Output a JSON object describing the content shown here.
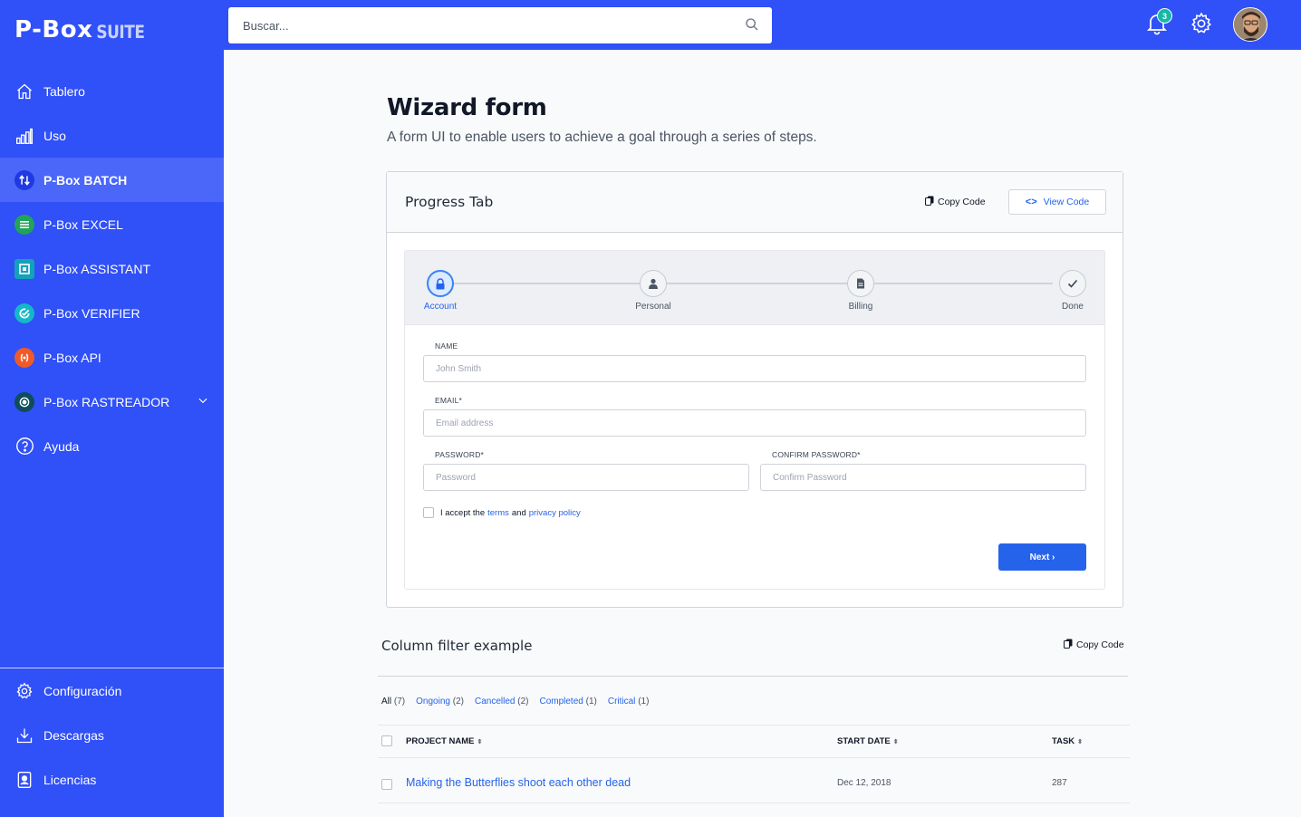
{
  "logo": {
    "main": "P-Box",
    "suffix": "SUITE"
  },
  "sidebar": {
    "items": [
      {
        "label": "Tablero",
        "icon": "home-icon"
      },
      {
        "label": "Uso",
        "icon": "bar-chart-icon"
      },
      {
        "label": "P-Box BATCH",
        "icon": "transfer-icon",
        "active": true
      },
      {
        "label": "P-Box EXCEL",
        "icon": "excel-icon"
      },
      {
        "label": "P-Box ASSISTANT",
        "icon": "assistant-icon"
      },
      {
        "label": "P-Box VERIFIER",
        "icon": "verifier-icon"
      },
      {
        "label": "P-Box API",
        "icon": "api-icon"
      },
      {
        "label": "P-Box RASTREADOR",
        "icon": "target-icon"
      },
      {
        "label": "Ayuda",
        "icon": "help-icon"
      }
    ],
    "bottom": [
      {
        "label": "Configuración",
        "icon": "gear-icon"
      },
      {
        "label": "Descargas",
        "icon": "download-icon"
      },
      {
        "label": "Licencias",
        "icon": "license-icon"
      }
    ]
  },
  "topbar": {
    "search_placeholder": "Buscar...",
    "notification_count": "3"
  },
  "main": {
    "title": "Wizard form",
    "subtitle": "A form UI to enable users to achieve a goal through a series of steps."
  },
  "card": {
    "title": "Progress Tab",
    "copy_label": "Copy Code",
    "view_label": "View Code",
    "view_glyph": "<>"
  },
  "wizard": {
    "steps": [
      {
        "label": "Account",
        "icon": "lock-icon",
        "active": true
      },
      {
        "label": "Personal",
        "icon": "user-icon"
      },
      {
        "label": "Billing",
        "icon": "document-icon"
      },
      {
        "label": "Done",
        "icon": "check-icon"
      }
    ],
    "fields": {
      "name_label": "Name",
      "name_placeholder": "John Smith",
      "email_label": "Email*",
      "email_placeholder": "Email address",
      "password_label": "Password*",
      "password_placeholder": "Password",
      "confirm_label": "Confirm Password*",
      "confirm_placeholder": "Confirm Password"
    },
    "accept_prefix": "I accept the",
    "terms": "terms",
    "accept_and": "and",
    "privacy": "privacy policy",
    "next": "Next ›"
  },
  "column_filter": {
    "title": "Column filter example",
    "copy_label": "Copy Code",
    "filters": [
      {
        "label": "All",
        "count": "(7)",
        "selected": true
      },
      {
        "label": "Ongoing",
        "count": "(2)"
      },
      {
        "label": "Cancelled",
        "count": "(2)"
      },
      {
        "label": "Completed",
        "count": "(1)"
      },
      {
        "label": "Critical",
        "count": "(1)"
      }
    ],
    "headers": {
      "project": "Project Name",
      "start": "Start Date",
      "task": "Task",
      "sort_glyph": "⬍"
    },
    "rows": [
      {
        "project": "Making the Butterflies shoot each other dead",
        "start": "Dec 12, 2018",
        "task": "287"
      }
    ]
  },
  "colors": {
    "brand": "#3050f8",
    "accent": "#2563eb",
    "badge": "#14b8a6"
  }
}
